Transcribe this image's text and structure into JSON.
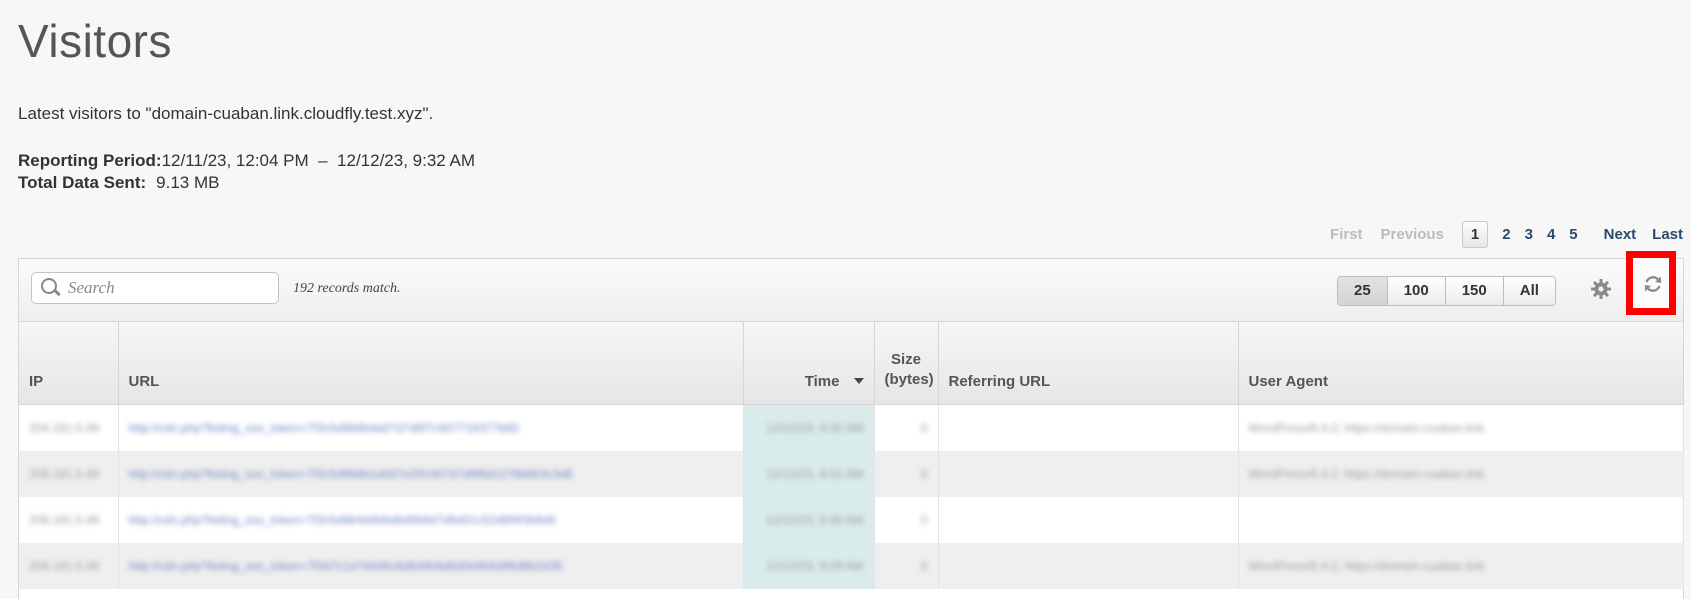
{
  "page": {
    "title": "Visitors",
    "subtitle": "Latest visitors to \"domain-cuaban.link.cloudfly.test.xyz\".",
    "reporting_period_label": "Reporting Period:",
    "reporting_period_value": "12/11/23, 12:04 PM  –  12/12/23, 9:32 AM",
    "total_data_label": "Total Data Sent:",
    "total_data_value": "9.13 MB"
  },
  "pagination": {
    "first": "First",
    "previous": "Previous",
    "pages": [
      "1",
      "2",
      "3",
      "4",
      "5"
    ],
    "current": "1",
    "next": "Next",
    "last": "Last"
  },
  "toolbar": {
    "search_placeholder": "Search",
    "records_match": "192 records match.",
    "page_sizes": [
      "25",
      "100",
      "150",
      "All"
    ],
    "selected_page_size": "25",
    "settings_icon": "gear-icon",
    "refresh_icon": "refresh-icon",
    "highlight_color": "#ff0000"
  },
  "table": {
    "columns": {
      "ip": "IP",
      "url": "URL",
      "time": "Time",
      "size": "Size (bytes)",
      "size_line1": "Size",
      "size_line2": "(bytes)",
      "referring_url": "Referring URL",
      "user_agent": "User Agent"
    },
    "sort": {
      "column": "Time",
      "direction": "descending"
    },
    "rows": [
      {
        "ip": "204.181.5.49",
        "url": "http://cdn.php?listing_sso_token=7f3c5d9b6b4a07d7d6f7c607716377b65",
        "time": "12/12/23, 9:32 AM",
        "size": "0",
        "referring_url": "",
        "user_agent": "WordPress/6.4.2; https://domain-cuaban.link"
      },
      {
        "ip": "208.181.5.49",
        "url": "http://cdn.php?listing_sso_token=7f3c5d9b6b1a0d7e291407d7d6f6d1276b6b3c3d8",
        "time": "12/12/23, 9:31 AM",
        "size": "0",
        "referring_url": "",
        "user_agent": "WordPress/6.4.2; https://domain-cuaban.link"
      },
      {
        "ip": "208.181.5.49",
        "url": "http://cdn.php?listing_sso_token=7f3c5d9b4d4b6d6d0b6d7d6d01c52d9f4f3b6d5",
        "time": "12/12/23, 9:30 AM",
        "size": "0",
        "referring_url": "",
        "user_agent": ""
      },
      {
        "ip": "208.181.5.49",
        "url": "http://cdn.php?listing_sso_token=7f3d7c1d7d4d9c6d6d4b6d6d0d4b6d96d6b2d36",
        "time": "12/12/23, 9:29 AM",
        "size": "0",
        "referring_url": "",
        "user_agent": "WordPress/6.4.2; https://domain-cuaban.link"
      }
    ]
  }
}
